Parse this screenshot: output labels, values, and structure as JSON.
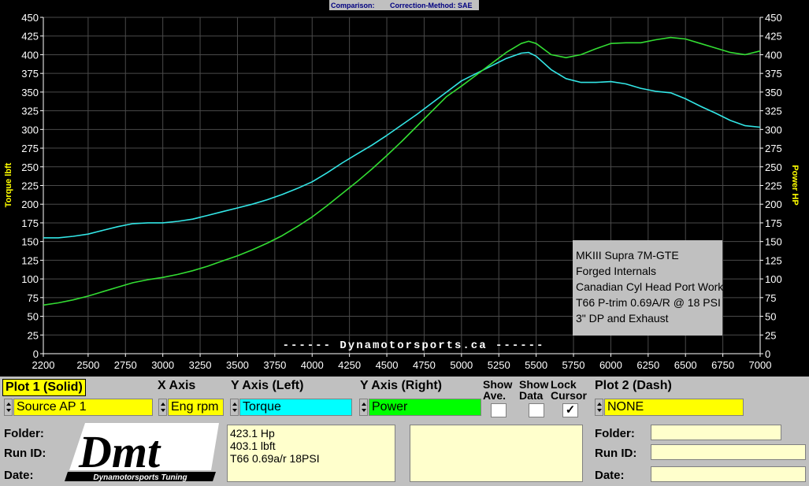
{
  "header": {
    "comparison_label": "Comparison:",
    "correction_label": "Correction-Method: SAE"
  },
  "chart_data": {
    "type": "line",
    "x_range": [
      2200,
      7000
    ],
    "x_ticks": [
      2200,
      2500,
      2750,
      3000,
      3250,
      3500,
      3750,
      4000,
      4250,
      4500,
      4750,
      5000,
      5250,
      5500,
      5750,
      6000,
      6250,
      6500,
      6750,
      7000
    ],
    "y_left_label": "Torque lbft",
    "y_right_label": "Power HP",
    "y_range": [
      0,
      450
    ],
    "y_ticks": [
      0,
      25,
      50,
      75,
      100,
      125,
      150,
      175,
      200,
      225,
      250,
      275,
      300,
      325,
      350,
      375,
      400,
      425,
      450
    ],
    "grid": true,
    "watermark": "------  Dynamotorsports.ca  ------",
    "annotation": [
      "MKIII Supra 7M-GTE",
      "Forged Internals",
      "Canadian Cyl Head Port Work",
      "T66 P-trim 0.69A/R @ 18 PSI",
      "3\" DP and Exhaust"
    ],
    "series": [
      {
        "color": "#33e6e6",
        "x": [
          2200,
          2300,
          2400,
          2500,
          2600,
          2700,
          2800,
          2900,
          3000,
          3100,
          3200,
          3300,
          3400,
          3500,
          3600,
          3700,
          3800,
          3900,
          4000,
          4100,
          4200,
          4300,
          4400,
          4500,
          4600,
          4700,
          4800,
          4900,
          5000,
          5100,
          5200,
          5300,
          5400,
          5450,
          5500,
          5600,
          5700,
          5800,
          5900,
          6000,
          6100,
          6200,
          6300,
          6400,
          6500,
          6600,
          6700,
          6800,
          6900,
          7000
        ],
        "values": [
          155,
          155,
          157,
          160,
          165,
          170,
          174,
          175,
          175,
          177,
          180,
          185,
          190,
          195,
          200,
          206,
          213,
          221,
          230,
          242,
          255,
          267,
          279,
          292,
          306,
          320,
          335,
          350,
          365,
          375,
          385,
          395,
          402,
          403,
          398,
          380,
          368,
          363,
          363,
          364,
          361,
          355,
          351,
          349,
          341,
          331,
          322,
          312,
          305,
          303
        ]
      },
      {
        "color": "#33dd33",
        "x": [
          2200,
          2300,
          2400,
          2500,
          2600,
          2700,
          2800,
          2900,
          3000,
          3100,
          3200,
          3300,
          3400,
          3500,
          3600,
          3700,
          3800,
          3900,
          4000,
          4100,
          4200,
          4300,
          4400,
          4500,
          4600,
          4700,
          4800,
          4900,
          5000,
          5100,
          5200,
          5300,
          5400,
          5450,
          5500,
          5600,
          5700,
          5800,
          5900,
          6000,
          6100,
          6200,
          6300,
          6400,
          6500,
          6600,
          6700,
          6800,
          6900,
          7000
        ],
        "values": [
          65,
          68,
          72,
          77,
          83,
          89,
          95,
          99,
          102,
          106,
          111,
          117,
          124,
          131,
          139,
          148,
          158,
          170,
          183,
          198,
          214,
          230,
          247,
          265,
          284,
          304,
          324,
          344,
          358,
          373,
          388,
          403,
          415,
          418,
          415,
          400,
          396,
          400,
          408,
          415,
          416,
          416,
          420,
          423,
          421,
          415,
          409,
          403,
          400,
          405
        ]
      }
    ]
  },
  "controls": {
    "plot1_label": "Plot 1 (Solid)",
    "xaxis_label": "X Axis",
    "yleft_label": "Y Axis (Left)",
    "yright_label": "Y Axis (Right)",
    "show_ave_label1": "Show",
    "show_ave_label2": "Ave.",
    "show_data_label1": "Show",
    "show_data_label2": "Data",
    "lock_cursor_label1": "Lock",
    "lock_cursor_label2": "Cursor",
    "plot2_label": "Plot 2 (Dash)",
    "source_value": "Source AP 1",
    "xaxis_value": "Eng rpm",
    "yleft_value": "Torque",
    "yright_value": "Power",
    "plot2_value": "NONE",
    "lock_cursor_checked": "✓",
    "colors": {
      "source": "#ffff00",
      "torque": "#00ffff",
      "power": "#00ff00",
      "plot2": "#ffff00"
    }
  },
  "info": {
    "folder_label": "Folder:",
    "runid_label": "Run ID:",
    "date_label": "Date:",
    "memo_lines": [
      "423.1 Hp",
      "403.1 lbft",
      "T66 0.69a/r 18PSI"
    ],
    "logo_text": "Dmt",
    "logo_caption": "Dynamotorsports Tuning"
  }
}
